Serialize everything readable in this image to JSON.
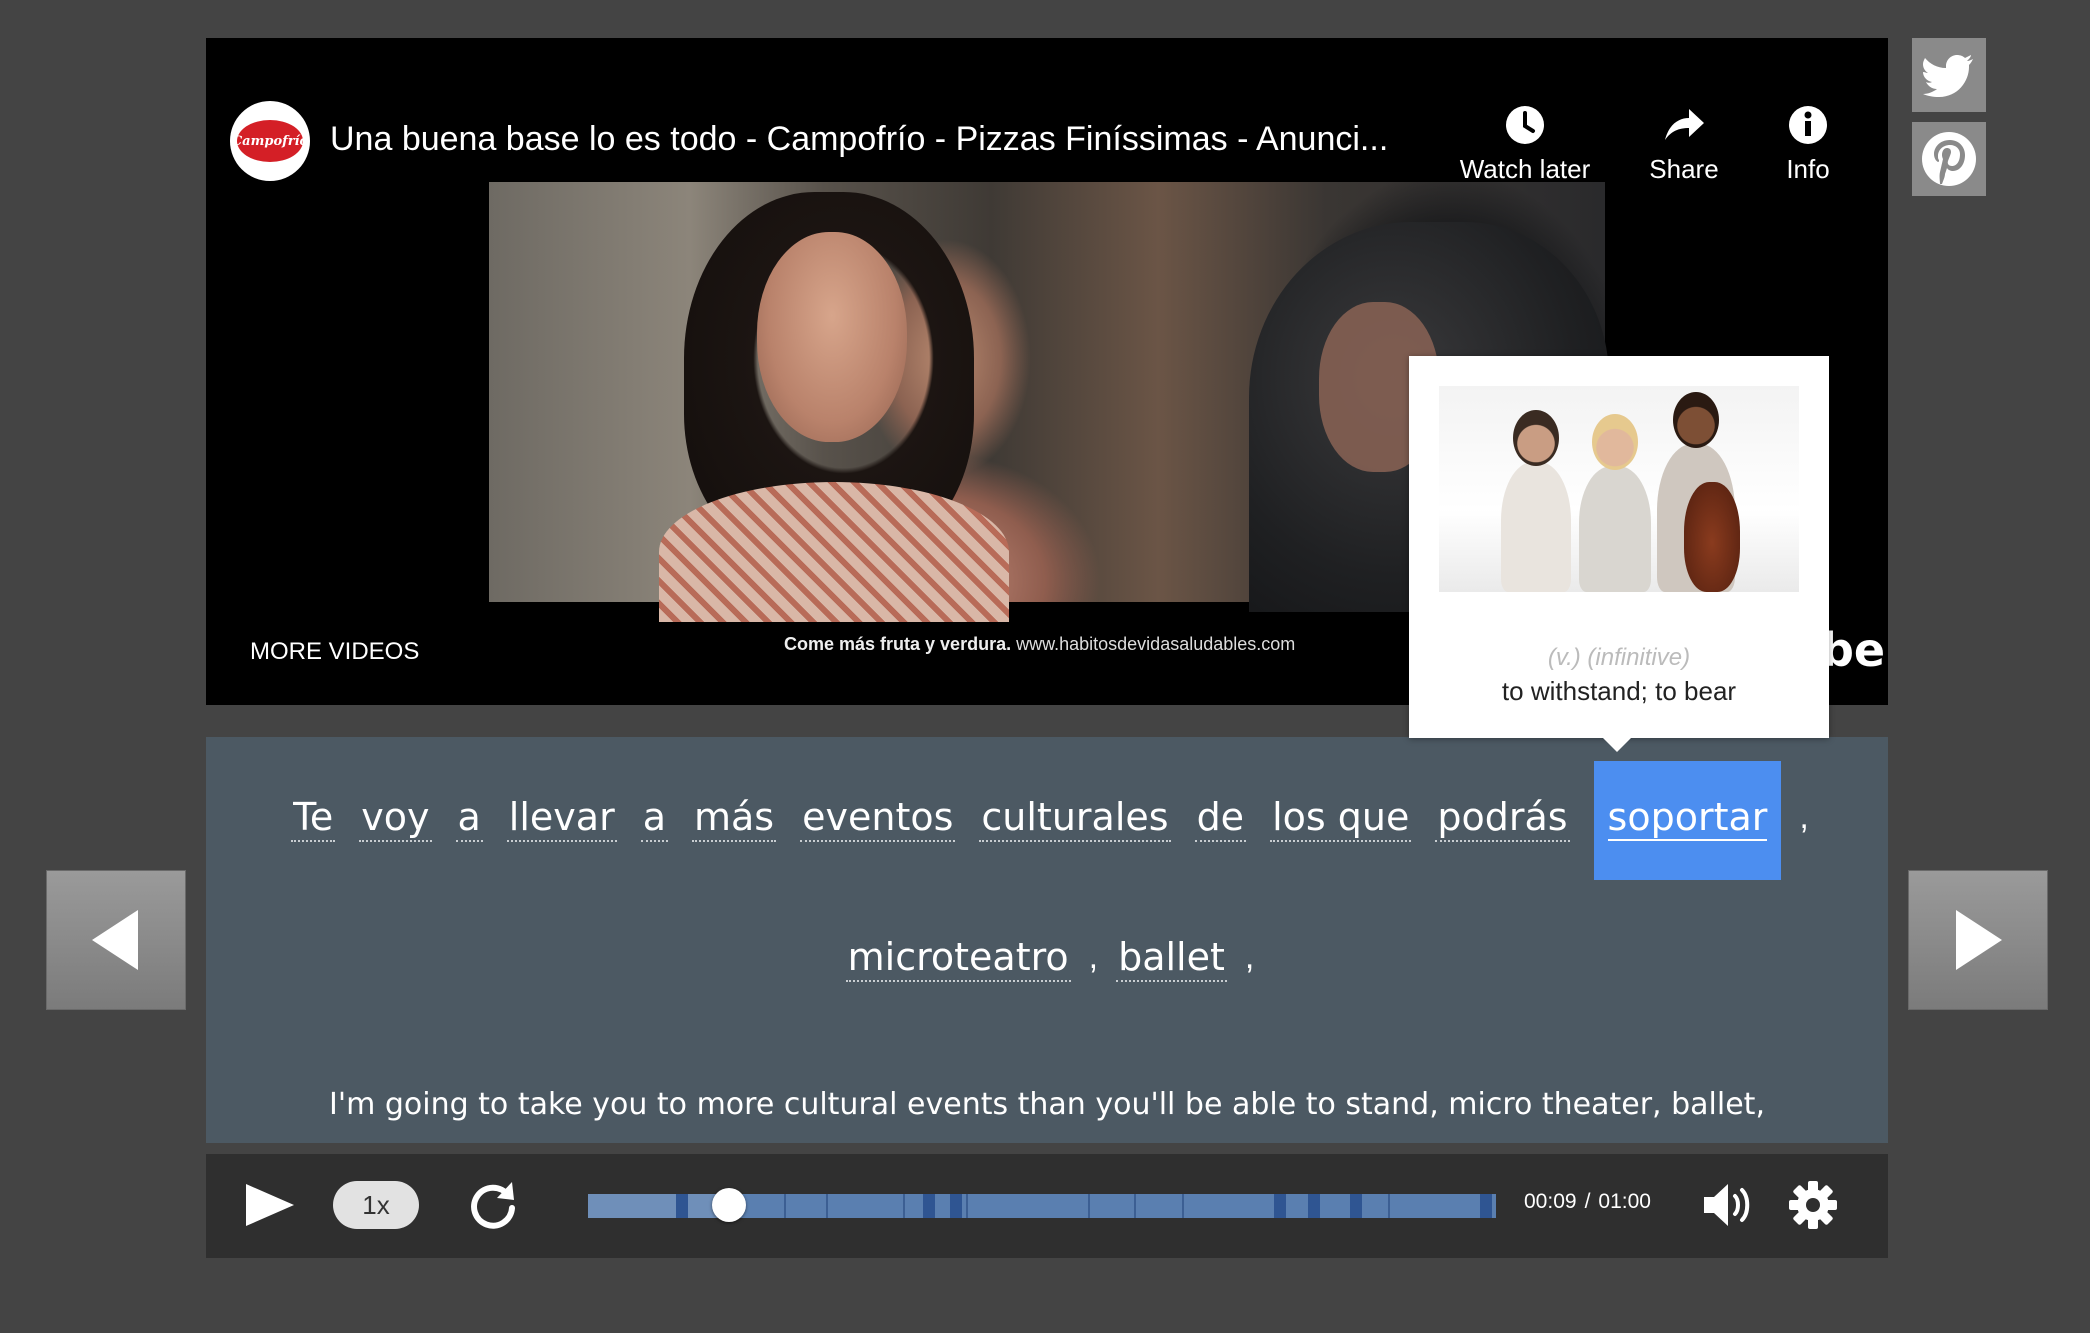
{
  "video": {
    "title": "Una buena base lo es todo - Campofrío - Pizzas Finíssimas - Anunci...",
    "channel_logo_text": "Campofrío",
    "buttons": [
      {
        "label": "Watch later",
        "icon": "clock-icon"
      },
      {
        "label": "Share",
        "icon": "share-arrow-icon"
      },
      {
        "label": "Info",
        "icon": "info-icon"
      }
    ],
    "more_videos": "MORE VIDEOS",
    "ad_caption_bold": "Come más fruta y verdura.",
    "ad_caption_url": "www.habitosdevidasaludables.com",
    "logo_fragment": "be"
  },
  "tooltip": {
    "pos": "(v.) (infinitive)",
    "definition": "to withstand; to bear"
  },
  "transcript": {
    "line1": [
      {
        "text": "Te"
      },
      {
        "text": "voy"
      },
      {
        "text": "a"
      },
      {
        "text": "llevar"
      },
      {
        "text": "a"
      },
      {
        "text": "más"
      },
      {
        "text": "eventos"
      },
      {
        "text": "culturales"
      },
      {
        "text": "de"
      },
      {
        "text": "los que"
      },
      {
        "text": "podrás"
      },
      {
        "text": "soportar",
        "active": true
      },
      {
        "punct": ","
      }
    ],
    "line2": [
      {
        "text": "microteatro"
      },
      {
        "punct": ","
      },
      {
        "text": "ballet"
      },
      {
        "punct": ","
      }
    ],
    "translation": "I'm going to take you to more cultural events than you'll be able to stand, micro theater, ballet,"
  },
  "controls": {
    "speed": "1x",
    "current_time": "00:09",
    "time_separator": "/",
    "duration": "01:00",
    "progress_fraction": 0.155
  },
  "share": {
    "twitter_icon": "twitter-bird-icon",
    "pinterest_icon": "pinterest-icon"
  },
  "colors": {
    "background": "#444444",
    "transcript_panel": "#4c5963",
    "active_word": "#4c8ef0",
    "progress_bar": "#5a7fb0"
  }
}
